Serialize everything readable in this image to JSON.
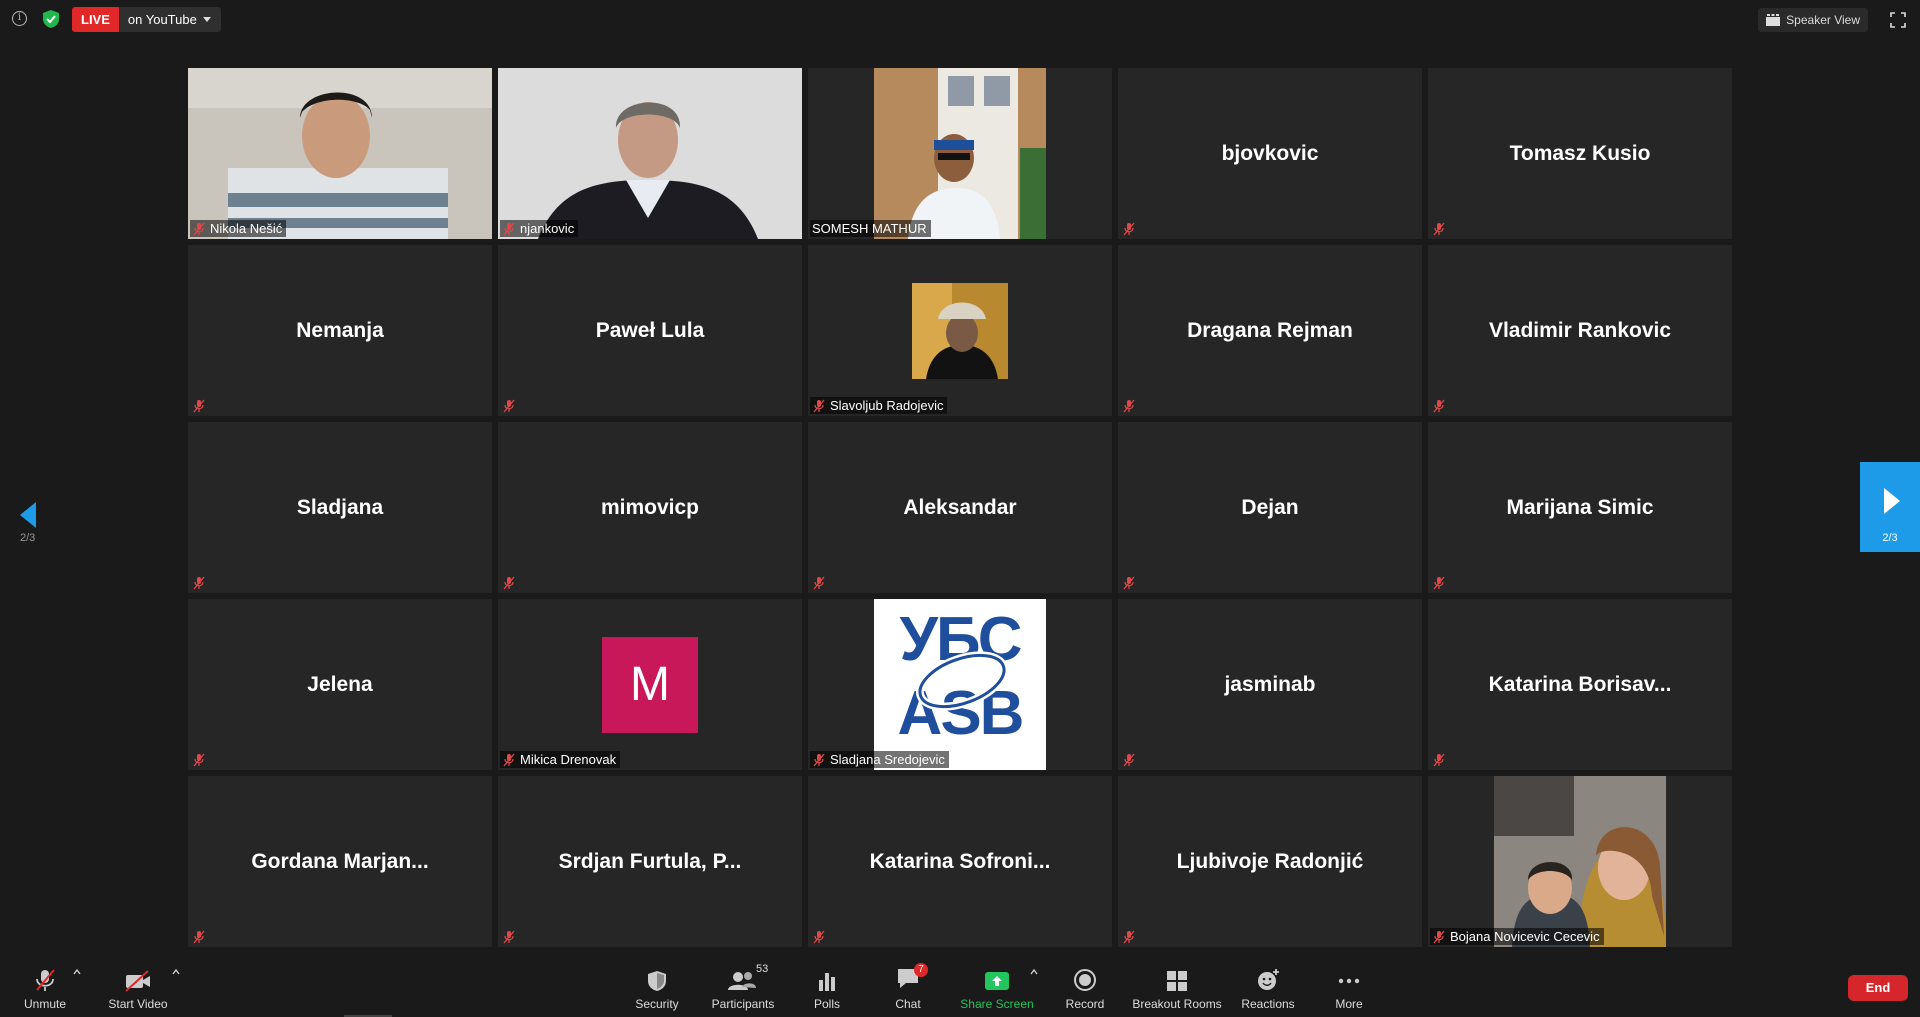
{
  "topbar": {
    "live_label": "LIVE",
    "live_target": "on YouTube",
    "view_mode": "Speaker View"
  },
  "paging": {
    "left_indicator": "2/3",
    "right_indicator": "2/3"
  },
  "participants": [
    {
      "name": "Nikola Nešić",
      "display": "video"
    },
    {
      "name": "njankovic",
      "display": "video"
    },
    {
      "name": "SOMESH MATHUR",
      "display": "video"
    },
    {
      "name": "bjovkovic",
      "display": "name"
    },
    {
      "name": "Tomasz Kusio",
      "display": "name"
    },
    {
      "name": "Nemanja",
      "display": "name"
    },
    {
      "name": "Paweł Lula",
      "display": "name"
    },
    {
      "name": "Slavoljub Radojevic",
      "display": "photo"
    },
    {
      "name": "Dragana Rejman",
      "display": "name"
    },
    {
      "name": "Vladimir Rankovic",
      "display": "name"
    },
    {
      "name": "Sladjana",
      "display": "name"
    },
    {
      "name": "mimovicp",
      "display": "name"
    },
    {
      "name": "Aleksandar",
      "display": "name"
    },
    {
      "name": "Dejan",
      "display": "name"
    },
    {
      "name": "Marijana Simic",
      "display": "name"
    },
    {
      "name": "Jelena",
      "display": "name"
    },
    {
      "name": "Mikica Drenovak",
      "display": "avatar",
      "avatar_letter": "M"
    },
    {
      "name": "Sladjana Sredojevic",
      "display": "logo",
      "logo_text_top": "УБС",
      "logo_text_bottom": "ASB"
    },
    {
      "name": "jasminab",
      "display": "name"
    },
    {
      "name": "Katarina  Borisav...",
      "display": "name"
    },
    {
      "name": "Gordana  Marjan...",
      "display": "name"
    },
    {
      "name": "Srdjan  Furtula,  P...",
      "display": "name"
    },
    {
      "name": "Katarina  Sofroni...",
      "display": "name"
    },
    {
      "name": "Ljubivoje Radonjić",
      "display": "name"
    },
    {
      "name": "Bojana Novicevic Cecevic",
      "display": "video"
    }
  ],
  "toolbar": {
    "unmute": "Unmute",
    "start_video": "Start Video",
    "security": "Security",
    "participants": "Participants",
    "participant_count": "53",
    "polls": "Polls",
    "chat": "Chat",
    "chat_badge": "7",
    "share_screen": "Share Screen",
    "record": "Record",
    "breakout_rooms": "Breakout Rooms",
    "reactions": "Reactions",
    "more": "More",
    "end": "End"
  },
  "colors": {
    "live": "#e02828",
    "share_screen": "#22c55e",
    "end": "#d5272b",
    "page_nav": "#1e9be8",
    "avatar_m": "#c8185a",
    "logo_blue": "#1f4f9c"
  }
}
